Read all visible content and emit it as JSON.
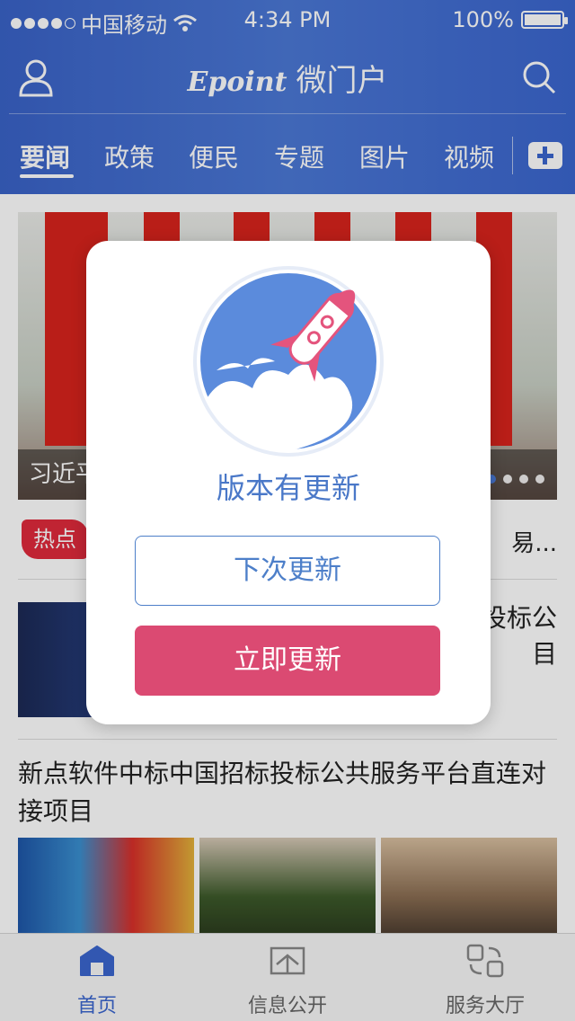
{
  "status_bar": {
    "carrier": "中国移动",
    "time": "4:34 PM",
    "battery": "100%",
    "battery_level": 1.0
  },
  "header": {
    "brand_logo": "Epoint",
    "title": "微门户"
  },
  "tabs": [
    {
      "label": "要闻",
      "active": true
    },
    {
      "label": "政策",
      "active": false
    },
    {
      "label": "便民",
      "active": false
    },
    {
      "label": "专题",
      "active": false
    },
    {
      "label": "图片",
      "active": false
    },
    {
      "label": "视频",
      "active": false
    }
  ],
  "hero": {
    "caption": "习近平",
    "pager_count": 5,
    "pager_active": 1
  },
  "hot": {
    "badge": "热点",
    "text": "易..."
  },
  "news": [
    {
      "title": "投标公\n目"
    },
    {
      "title": "新点软件中标中国招标投标公共服务平台直连对接项目"
    }
  ],
  "dialog": {
    "title": "版本有更新",
    "later_label": "下次更新",
    "now_label": "立即更新"
  },
  "bottom_nav": [
    {
      "label": "首页",
      "icon": "home-icon",
      "active": true
    },
    {
      "label": "信息公开",
      "icon": "book-icon",
      "active": false
    },
    {
      "label": "服务大厅",
      "icon": "service-hall-icon",
      "active": false
    }
  ],
  "colors": {
    "header_blue": "#3b66cf",
    "accent_pink": "#db4a72",
    "dialog_title_blue": "#4a78c8",
    "hot_red": "#e02a3c"
  }
}
